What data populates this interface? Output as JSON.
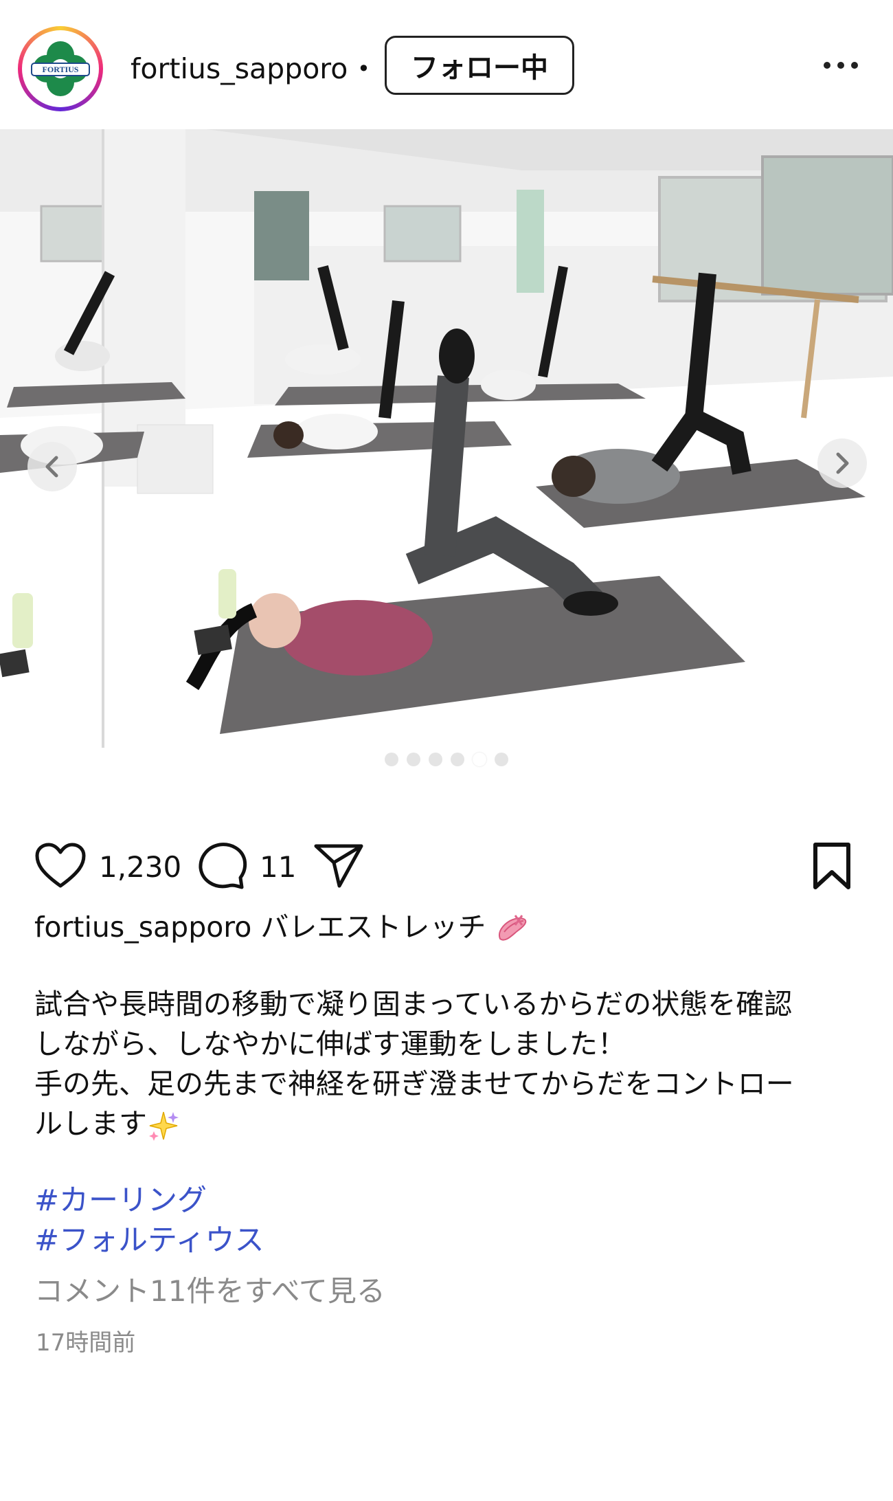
{
  "header": {
    "username": "fortius_sapporo",
    "separator": "•",
    "follow_label": "フォロー中",
    "avatar_text": "FORTIUS"
  },
  "carousel": {
    "dot_count": 6,
    "active_index": 4
  },
  "actions": {
    "likes": "1,230",
    "comments": "11"
  },
  "post": {
    "caption_user": "fortius_sapporo",
    "caption_title": "バレエストレッチ",
    "body_lines": [
      "試合や長時間の移動で凝り固まっているからだの状態を確認",
      "しながら、しなやかに伸ばす運動をしました！",
      "手の先、足の先まで神経を研ぎ澄ませてからだをコントロー",
      "ルします"
    ],
    "hashtags": [
      "#カーリング",
      "#フォルティウス"
    ],
    "view_comments": "コメント11件をすべて見る",
    "timestamp": "17時間前"
  },
  "colors": {
    "hashtag": "#3b53c9",
    "muted": "#8a8a8a",
    "mat": "#6a6869"
  }
}
